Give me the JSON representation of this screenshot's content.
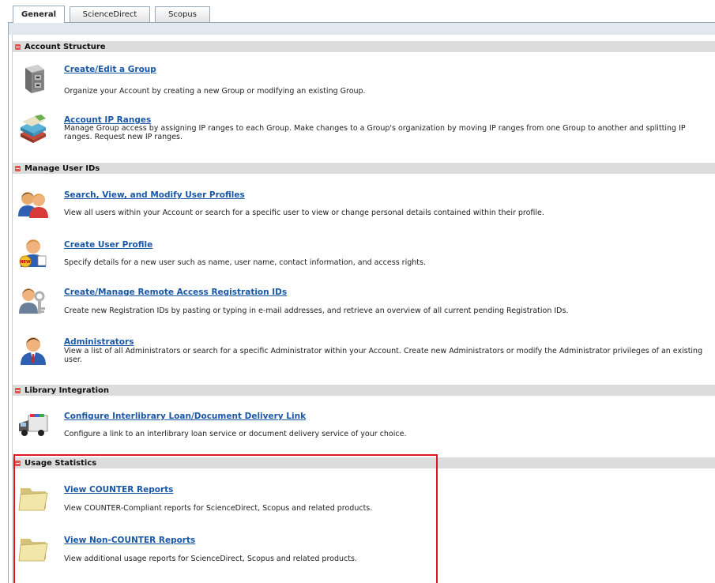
{
  "tabs": [
    "General",
    "ScienceDirect",
    "Scopus"
  ],
  "sections": {
    "account": "Account Structure",
    "users": "Manage User IDs",
    "library": "Library Integration",
    "usage": "Usage Statistics"
  },
  "items": {
    "group": {
      "title": "Create/Edit a Group",
      "desc": "Organize your Account by creating a new Group or modifying an existing Group."
    },
    "ip": {
      "title": "Account IP Ranges",
      "desc": "Manage Group access by assigning IP ranges to each Group. Make changes to a Group's organization by moving IP ranges from one Group to another and splitting IP ranges.  Request new IP ranges."
    },
    "search": {
      "title": "Search, View, and Modify User Profiles",
      "desc": "View all users within your Account or search for a specific user to view or change personal details contained within their profile."
    },
    "create_user": {
      "title": "Create User Profile",
      "desc": "Specify details for a new user such as name, user name, contact information, and access rights."
    },
    "remote": {
      "title": "Create/Manage Remote Access Registration IDs",
      "desc": "Create new Registration IDs by pasting or typing in e-mail addresses, and retrieve an overview of all current pending Registration IDs."
    },
    "admins": {
      "title": "Administrators",
      "desc": "View a list of all Administrators or search for a specific Administrator within your Account. Create new Administrators or modify the Administrator privileges of an existing user."
    },
    "ill": {
      "title": "Configure Interlibrary Loan/Document Delivery Link",
      "desc": "Configure a link to an interlibrary loan service or document delivery service of your choice."
    },
    "counter": {
      "title": "View COUNTER Reports",
      "desc": "View COUNTER-Compliant reports for ScienceDirect, Scopus and related products."
    },
    "noncounter": {
      "title": "View Non-COUNTER Reports",
      "desc": "View additional usage reports for ScienceDirect, Scopus and related products."
    }
  },
  "icons": {
    "group": "file-cabinet-icon",
    "ip": "stacked-layers-icon",
    "search": "users-pair-icon",
    "create_user": "new-user-icon",
    "remote": "user-keys-icon",
    "admins": "administrator-icon",
    "ill": "delivery-truck-icon",
    "counter": "folder-icon",
    "noncounter": "folder-icon"
  },
  "colors": {
    "link": "#1a58a5",
    "section_bg": "#dcdcdc",
    "highlight": "#e0161b",
    "minus": "#e0554e"
  }
}
